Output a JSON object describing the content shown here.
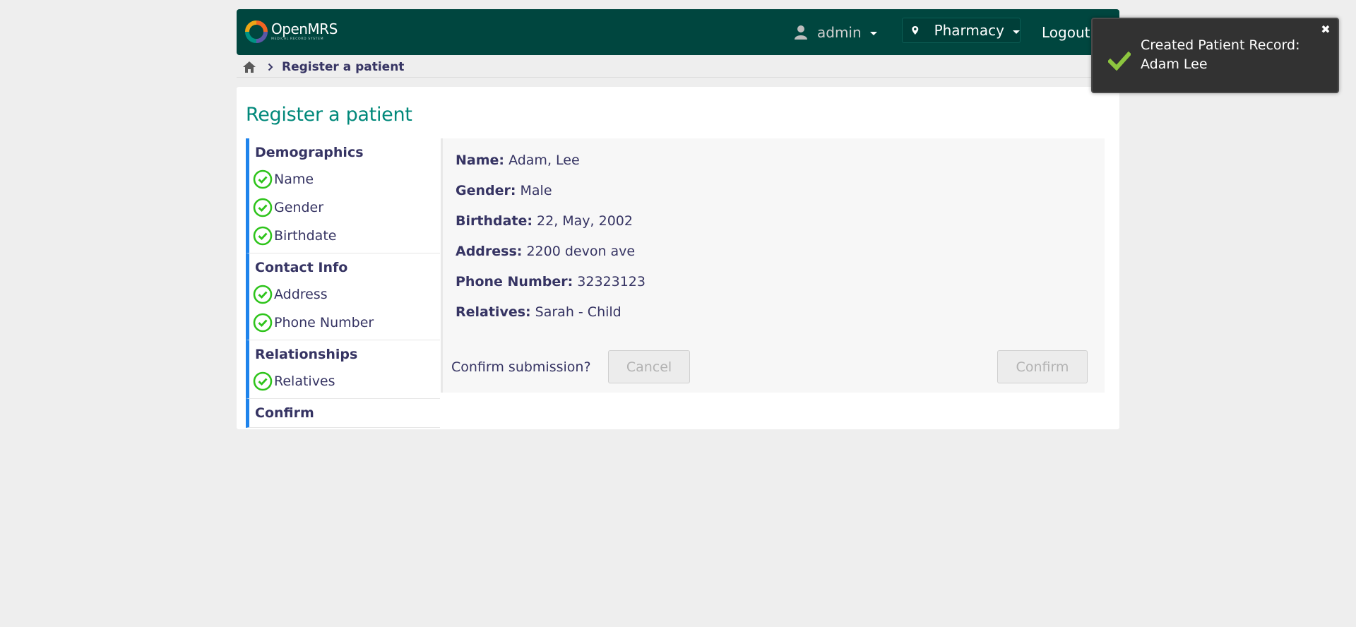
{
  "header": {
    "logo_text": "OpenMRS",
    "logo_subtext": "MEDICAL RECORD SYSTEM",
    "user": "admin",
    "location": "Pharmacy",
    "logout": "Logout"
  },
  "breadcrumb": {
    "current": "Register a patient"
  },
  "page": {
    "title": "Register a patient"
  },
  "steps": {
    "sections": [
      {
        "title": "Demographics",
        "items": [
          "Name",
          "Gender",
          "Birthdate"
        ]
      },
      {
        "title": "Contact Info",
        "items": [
          "Address",
          "Phone Number"
        ]
      },
      {
        "title": "Relationships",
        "items": [
          "Relatives"
        ]
      },
      {
        "title": "Confirm",
        "items": []
      }
    ]
  },
  "review": {
    "fields": [
      {
        "label": "Name:",
        "value": "Adam, Lee"
      },
      {
        "label": "Gender:",
        "value": "Male"
      },
      {
        "label": "Birthdate:",
        "value": "22, May, 2002"
      },
      {
        "label": "Address:",
        "value": "2200 devon ave"
      },
      {
        "label": "Phone Number:",
        "value": "32323123"
      },
      {
        "label": "Relatives:",
        "value": "Sarah - Child"
      }
    ],
    "confirm_prompt": "Confirm submission?",
    "cancel_label": "Cancel",
    "confirm_label": "Confirm"
  },
  "toast": {
    "line1": "Created Patient Record:",
    "line2": "Adam Lee",
    "close": "✖"
  },
  "colors": {
    "header_bg": "#00463f",
    "title_teal": "#00887a",
    "step_accent": "#1f84ec",
    "check_green": "#2ec41b",
    "text": "#363463"
  }
}
